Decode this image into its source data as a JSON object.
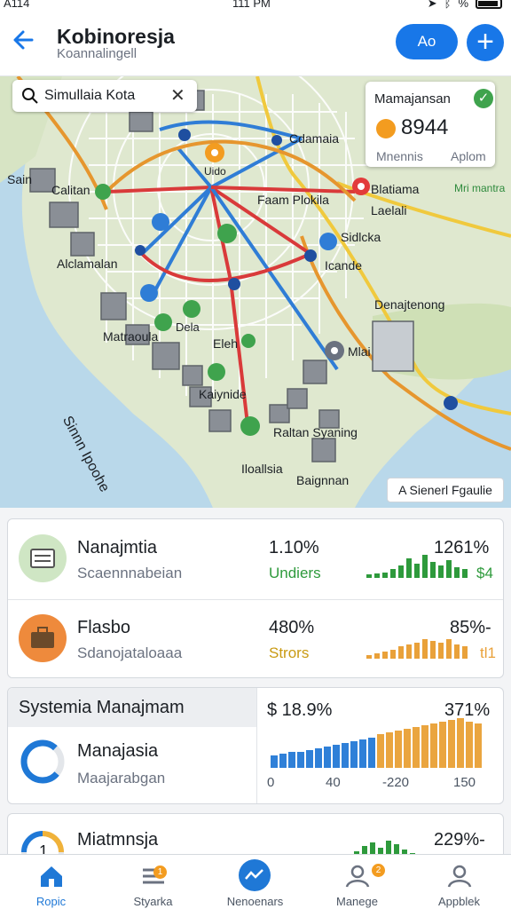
{
  "status_bar": {
    "left": "A114",
    "time": "111 PM",
    "right": "%"
  },
  "header": {
    "title": "Kobinoresja",
    "subtitle": "Koannalingell",
    "button_label": "Ao",
    "add_symbol": "+"
  },
  "map": {
    "search_text": "Simullaia Kota",
    "labels": [
      "Cdamaia",
      "Uido",
      "Sain",
      "Calitan",
      "Faam Plokila",
      "Blatiama",
      "Laelali",
      "Mri mantra",
      "Sidlcka",
      "Icande",
      "Alclamalan",
      "Denajtenong",
      "Matraoula",
      "Dela",
      "Eleh",
      "Mlai",
      "Kaiynide",
      "Raltan Syaning",
      "Iloallsia",
      "Baignnan",
      "Sinnn Ipoohe"
    ],
    "card": {
      "title": "Mamajansan",
      "value": "8944",
      "left": "Mnennis",
      "right": "Aplom",
      "check": "✓"
    },
    "legend_chip": "A Sienerl Fgaulie"
  },
  "rows": [
    {
      "title": "Nanajmtia",
      "subtitle": "Scaennnabeian",
      "pct": "1.10%",
      "tag": "Undiers",
      "right": "1261%",
      "small": "$4",
      "color": "#2e9a3c"
    },
    {
      "title": "Flasbo",
      "subtitle": "Sdanojataloaaa",
      "pct": "480%",
      "tag": "Strors",
      "right": "85%-",
      "small": "tl1",
      "color": "#e9a13a"
    }
  ],
  "panel": {
    "heading": "Systemia Manajmam",
    "title": "Manajasia",
    "subtitle": "Maajarabgan",
    "stat_left": "$ 18.9%",
    "stat_right": "371%",
    "axis": [
      "0",
      "40",
      "-220",
      "150"
    ]
  },
  "bottom_card": {
    "title": "Miatmnsja",
    "pct": "229%-",
    "digit": "1"
  },
  "nav": [
    {
      "label": "Ropic"
    },
    {
      "label": "Styarka",
      "badge": "1"
    },
    {
      "label": "Nenoenars"
    },
    {
      "label": "Manege",
      "badge": "2"
    },
    {
      "label": "Appblek"
    }
  ],
  "colors": {
    "accent": "#1877e8",
    "green": "#2e9a3c",
    "orange": "#e9a13a",
    "blue_bar": "#2f80d8",
    "orange_bar": "#eaa53f"
  }
}
